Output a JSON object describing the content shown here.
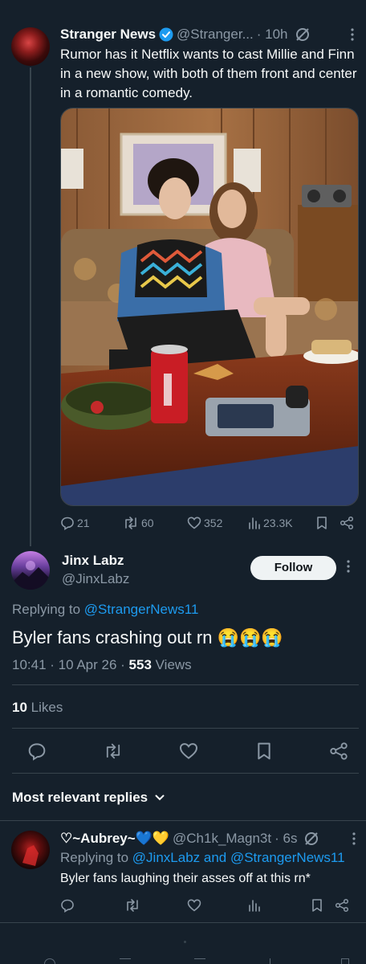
{
  "parent_tweet": {
    "author_name": "Stranger News",
    "author_handle": "@Stranger...",
    "time": "· 10h",
    "text": "Rumor has it Netflix wants to cast Millie and Finn in a new show, with both of them front and center in a romantic comedy.",
    "stats": {
      "replies": "21",
      "reposts": "60",
      "likes": "352",
      "views": "23.3K"
    }
  },
  "main_tweet": {
    "author_name": "Jinx Labz",
    "author_handle": "@JinxLabz",
    "follow_label": "Follow",
    "replying_prefix": "Replying to",
    "replying_to": "@StrangerNews11",
    "text": "Byler fans crashing out rn 😭😭😭",
    "timestamp": "10:41 · 10 Apr 26 · ",
    "views_count": "553",
    "views_label": " Views",
    "likes_count": "10",
    "likes_label": " Likes"
  },
  "replies_section": {
    "sort_label": "Most relevant replies"
  },
  "reply_tweet": {
    "author_name": "♡~Aubrey~💙💛",
    "author_handle": "@Ch1k_Magn3t",
    "time": "· 6s",
    "replying_prefix": "Replying to",
    "replying_to": "@JinxLabz and @StrangerNews11",
    "text": "Byler fans laughing their asses off at this rn*"
  },
  "colors": {
    "background": "#15202b",
    "accent": "#1d9bf0",
    "muted": "#8b98a5",
    "border": "#38444d"
  }
}
